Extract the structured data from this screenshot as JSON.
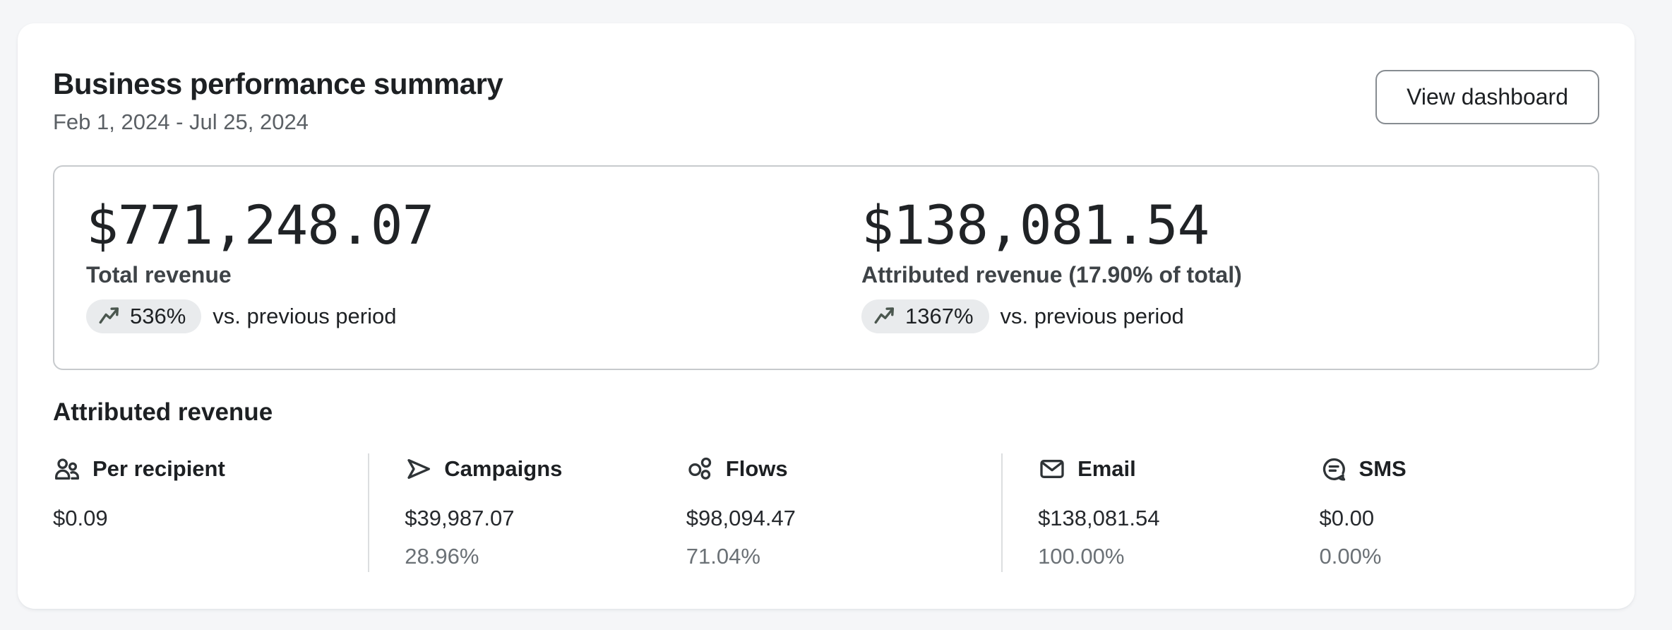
{
  "header": {
    "title": "Business performance summary",
    "date_range": "Feb 1, 2024 - Jul 25, 2024",
    "actions": {
      "view_dashboard": "View dashboard"
    }
  },
  "summary": {
    "metrics": [
      {
        "value": "$771,248.07",
        "label": "Total revenue",
        "change": "536%",
        "change_icon": "trending-up-icon",
        "comparison": "vs. previous period"
      },
      {
        "value": "$138,081.54",
        "label": "Attributed revenue (17.90% of total)",
        "change": "1367%",
        "change_icon": "trending-up-icon",
        "comparison": "vs. previous period"
      }
    ]
  },
  "attributed": {
    "heading": "Attributed revenue",
    "columns": [
      {
        "icon": "people-icon",
        "label": "Per recipient",
        "value": "$0.09"
      },
      {
        "icon": "send-icon",
        "label": "Campaigns",
        "value": "$39,987.07",
        "percent": "28.96%"
      },
      {
        "icon": "flows-icon",
        "label": "Flows",
        "value": "$98,094.47",
        "percent": "71.04%"
      },
      {
        "icon": "email-icon",
        "label": "Email",
        "value": "$138,081.54",
        "percent": "100.00%"
      },
      {
        "icon": "sms-icon",
        "label": "SMS",
        "value": "$0.00",
        "percent": "0.00%"
      }
    ]
  },
  "colors": {
    "page_background": "#f5f6f8",
    "card_background": "#ffffff",
    "text_primary": "#1d2023",
    "text_secondary": "#5b6065",
    "badge_background": "#e9ebed",
    "badge_icon_color": "#4b574f",
    "divider": "#dcdee0",
    "box_border": "#c7cacd"
  }
}
